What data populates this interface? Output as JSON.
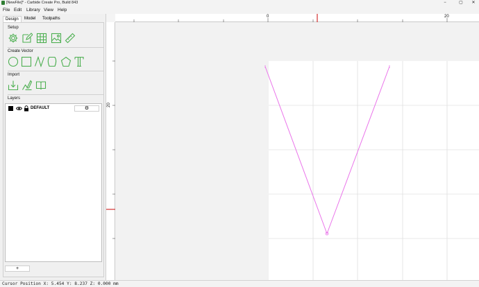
{
  "window": {
    "title": "[NewFile]* - Carbide Create Pro, Build 843",
    "minimize": "−",
    "maximize": "▢",
    "close": "✕"
  },
  "menu": {
    "file": "File",
    "edit": "Edit",
    "library": "Library",
    "view": "View",
    "help": "Help"
  },
  "tabs": {
    "design": "Design",
    "model": "Model",
    "toolpaths": "Toolpaths"
  },
  "sections": {
    "setup": "Setup",
    "create_vector": "Create Vector",
    "import": "Import",
    "layers": "Layers"
  },
  "setup_icons": [
    "gear-icon",
    "edit-icon",
    "grid-icon",
    "image-icon",
    "ruler-icon"
  ],
  "vector_icons": [
    "circle-icon",
    "rectangle-icon",
    "curve-icon",
    "polygon-icon",
    "pentagon-icon",
    "text-icon"
  ],
  "import_icons": [
    "import-icon",
    "import-svg-icon",
    "book-icon"
  ],
  "layer": {
    "name": "DEFAULT",
    "settings": "⚙"
  },
  "add_layer": "+",
  "ruler": {
    "x0": "0",
    "x20": "20",
    "y20": "20"
  },
  "status": {
    "cursor": "Cursor Position X: 5.454 Y: 8.237 Z: 0.000 mm"
  },
  "colors": {
    "vector": "#ea74ea",
    "ruler_marker": "#d32f2f",
    "icon_green": "#4caf50",
    "work_area": "#ffffff",
    "canvas_bg": "#f2f2f2"
  }
}
